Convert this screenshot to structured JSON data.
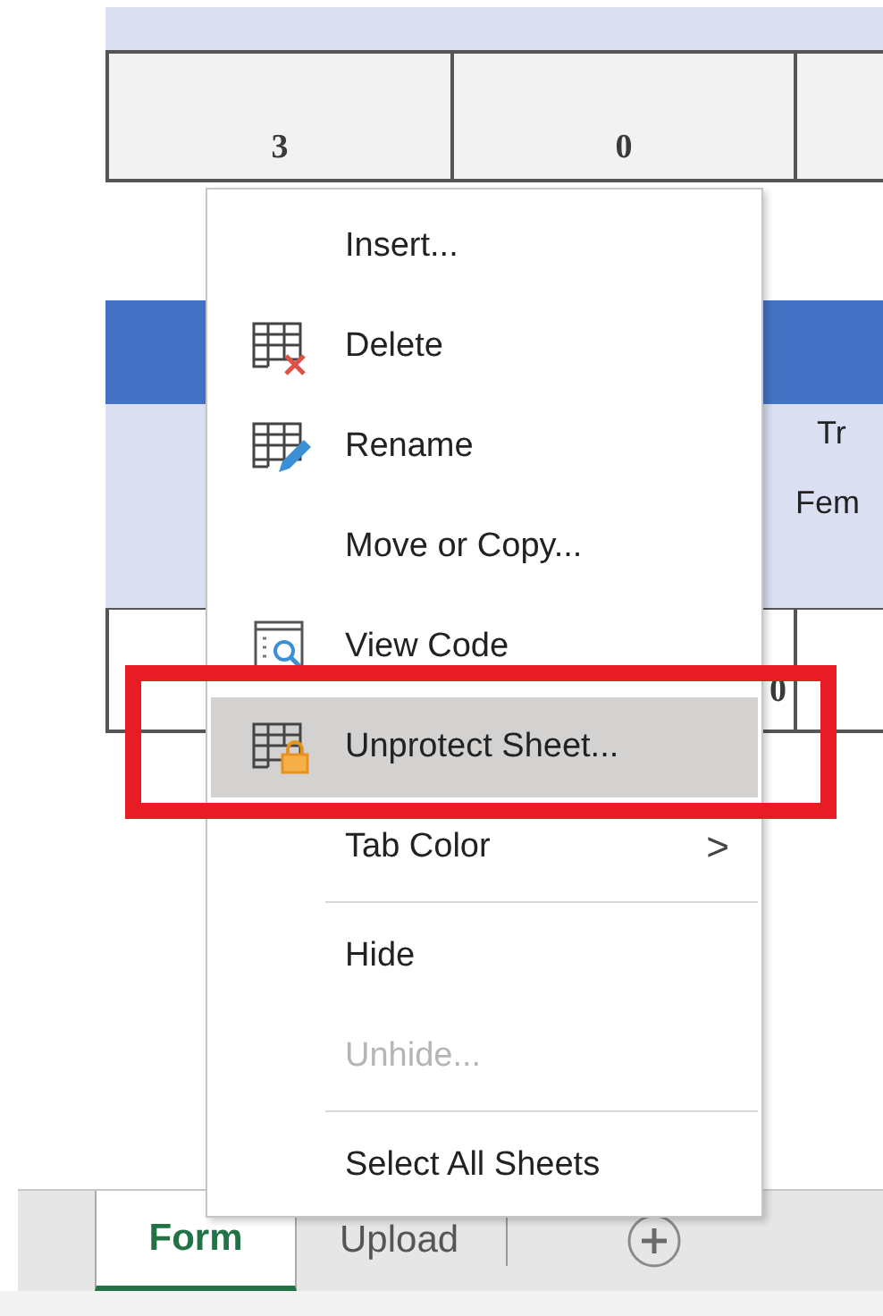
{
  "sheet": {
    "row_1": [
      "3",
      "0"
    ],
    "header_text": [
      "Tr",
      "Fem"
    ],
    "row_3_middle": "0"
  },
  "context_menu": [
    {
      "kind": "command",
      "label": "Insert...",
      "selected": false,
      "disabled": false
    },
    {
      "kind": "command",
      "label": "Delete",
      "selected": false,
      "disabled": false
    },
    {
      "kind": "command",
      "label": "Rename",
      "selected": false,
      "disabled": false
    },
    {
      "kind": "command",
      "label": "Move or Copy...",
      "selected": false,
      "disabled": false
    },
    {
      "kind": "command",
      "label": "View Code",
      "selected": false,
      "disabled": false
    },
    {
      "kind": "command",
      "label": "Unprotect Sheet...",
      "selected": true,
      "disabled": false
    },
    {
      "kind": "submenu",
      "label": "Tab Color",
      "arrow": ">",
      "selected": false,
      "disabled": false
    },
    {
      "kind": "separator"
    },
    {
      "kind": "command",
      "label": "Hide",
      "selected": false,
      "disabled": false
    },
    {
      "kind": "command",
      "label": "Unhide...",
      "selected": false,
      "disabled": true
    },
    {
      "kind": "separator"
    },
    {
      "kind": "command",
      "label": "Select All Sheets",
      "selected": false,
      "disabled": false
    }
  ],
  "sheet_tabs": [
    {
      "label": "Form",
      "selected": true
    },
    {
      "label": "Upload",
      "selected": false
    }
  ]
}
